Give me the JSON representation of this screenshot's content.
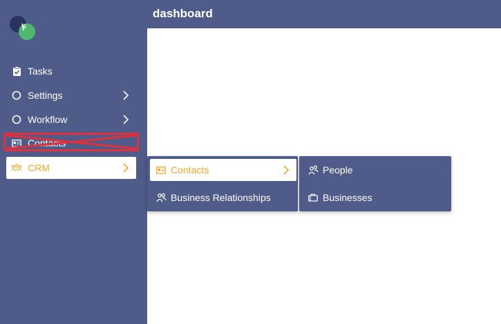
{
  "header": {
    "title": "dashboard"
  },
  "sidebar": {
    "items": [
      {
        "label": "Tasks"
      },
      {
        "label": "Settings"
      },
      {
        "label": "Workflow"
      },
      {
        "label": "Contacts"
      },
      {
        "label": "CRM"
      }
    ]
  },
  "crm_menu": {
    "items": [
      {
        "label": "Contacts"
      },
      {
        "label": "Business Relationships"
      }
    ]
  },
  "contacts_menu": {
    "items": [
      {
        "label": "People"
      },
      {
        "label": "Businesses"
      }
    ]
  },
  "colors": {
    "sidebar_bg": "#4f5b88",
    "accent": "#f5a623",
    "annotation": "#e0303a",
    "logo_dark": "#2a3260",
    "logo_green": "#4cb96f"
  }
}
